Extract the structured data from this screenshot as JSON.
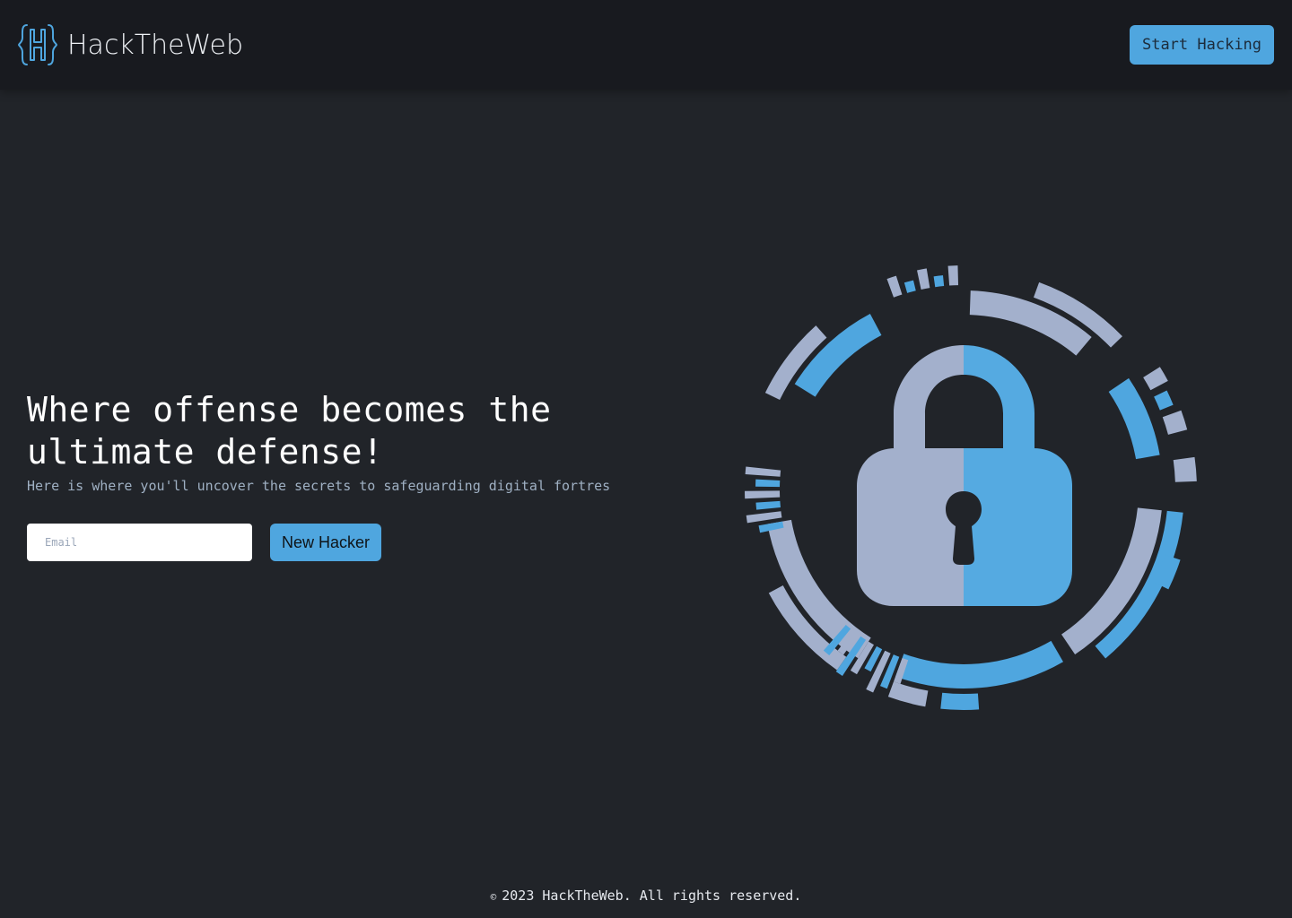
{
  "brand": {
    "name": "HackTheWeb",
    "logo_icon": "braces-h-logo-icon",
    "logo_color": "#4fa6df"
  },
  "header": {
    "cta_label": "Start Hacking"
  },
  "hero": {
    "title": "Where offense becomes the ultimate defense!",
    "subtitle": "Here is where you'll uncover the secrets to safeguarding digital fortres",
    "email_placeholder": "Email",
    "submit_label": "New Hacker",
    "illustration_icon": "padlock-shield-icon"
  },
  "footer": {
    "copyright_symbol": "©",
    "text": "2023 HackTheWeb. All rights reserved."
  },
  "colors": {
    "background": "#212429",
    "navbar": "#181a1f",
    "accent": "#4fa6df",
    "lock_gray": "#a3b0cc",
    "subtitle": "#9fb0c3"
  }
}
